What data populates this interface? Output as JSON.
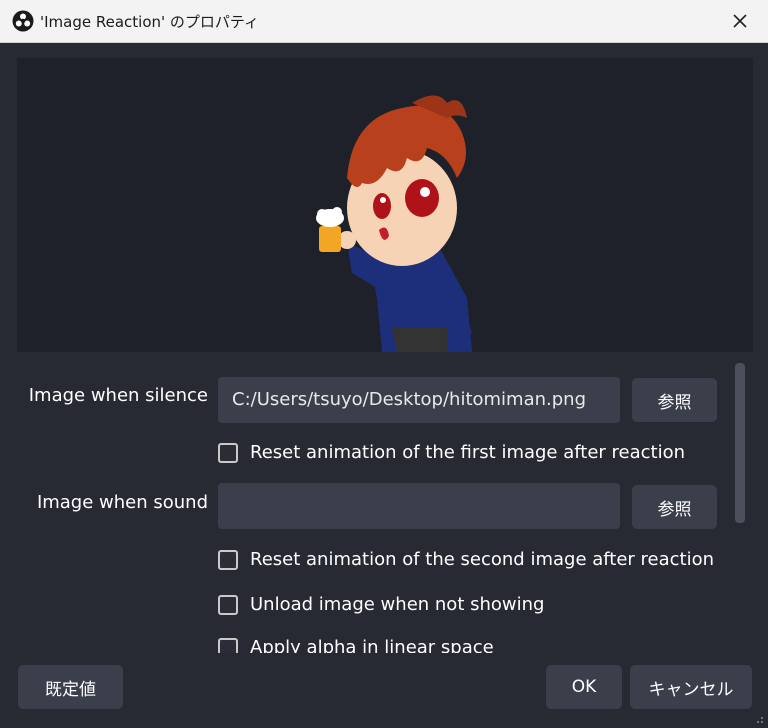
{
  "window": {
    "title": "'Image Reaction' のプロパティ",
    "close_icon": "close-icon"
  },
  "properties": {
    "silence_label": "Image when silence",
    "silence_value": "C:/Users/tsuyo/Desktop/hitomiman.png",
    "browse_label_1": "参照",
    "reset_first_label": "Reset animation of the first image after reaction",
    "sound_label": "Image when sound",
    "sound_value": "",
    "browse_label_2": "参照",
    "reset_second_label": "Reset animation of the second image after reaction",
    "unload_label": "Unload image when not showing",
    "alpha_label": "Apply alpha in linear space"
  },
  "footer": {
    "defaults_label": "既定値",
    "ok_label": "OK",
    "cancel_label": "キャンセル"
  },
  "colors": {
    "background": "#272a33",
    "preview_bg": "#1f212a",
    "field_bg": "#3a3f4b",
    "button_bg": "#3b3f4b"
  }
}
